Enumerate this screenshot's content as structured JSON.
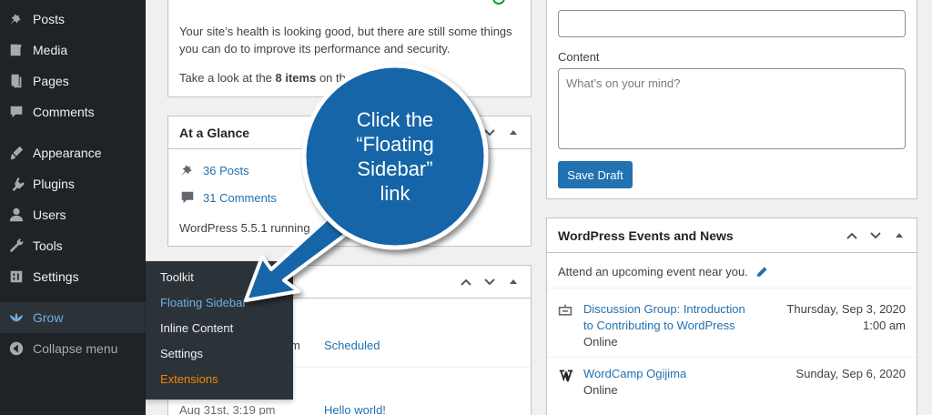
{
  "sidebar": {
    "items": [
      {
        "label": "Posts",
        "icon": "pin-icon"
      },
      {
        "label": "Media",
        "icon": "media-icon"
      },
      {
        "label": "Pages",
        "icon": "pages-icon"
      },
      {
        "label": "Comments",
        "icon": "comments-icon"
      },
      {
        "label": "Appearance",
        "icon": "appearance-icon"
      },
      {
        "label": "Plugins",
        "icon": "plugins-icon"
      },
      {
        "label": "Users",
        "icon": "users-icon"
      },
      {
        "label": "Tools",
        "icon": "tools-icon"
      },
      {
        "label": "Settings",
        "icon": "settings-icon"
      },
      {
        "label": "Grow",
        "icon": "grow-icon"
      },
      {
        "label": "Collapse menu",
        "icon": "collapse-icon"
      }
    ],
    "flyout": [
      "Toolkit",
      "Floating Sidebar",
      "Inline Content",
      "Settings",
      "Extensions"
    ]
  },
  "health": {
    "line1": "Your site’s health is looking good, but there are still some things",
    "line2": "you can do to improve its performance and security.",
    "line3_pre": "Take a look at the ",
    "line3_bold": "8 items",
    "line3_post": " on th"
  },
  "glance": {
    "title": "At a Glance",
    "posts": "36 Posts",
    "comments": "31 Comments",
    "version": "WordPress 5.5.1 running"
  },
  "activity": {
    "time_fragment": "m",
    "scheduled": "Scheduled",
    "date": "Aug 31st, 3:19 pm",
    "post_link": "Hello world!"
  },
  "draft": {
    "content_label": "Content",
    "content_placeholder": "What’s on your mind?",
    "save_label": "Save Draft"
  },
  "events": {
    "title": "WordPress Events and News",
    "intro": "Attend an upcoming event near you.",
    "items": [
      {
        "title1": "Discussion Group: Introduction",
        "title2": "to Contributing to WordPress",
        "location": "Online",
        "date": "Thursday, Sep 3, 2020",
        "time": "1:00 am"
      },
      {
        "title1": "WordCamp Ogijima",
        "title2": "",
        "location": "Online",
        "date": "Sunday, Sep 6, 2020",
        "time": ""
      }
    ]
  },
  "callout": {
    "line1": "Click the",
    "line2": "“Floating",
    "line3": "Sidebar”",
    "line4": "link"
  },
  "colors": {
    "sidebar_bg": "#1d2327",
    "flyout_bg": "#2c3338",
    "link": "#2271b1",
    "active": "#72aee6",
    "extensions": "#f18500",
    "callout": "#1565a8"
  }
}
